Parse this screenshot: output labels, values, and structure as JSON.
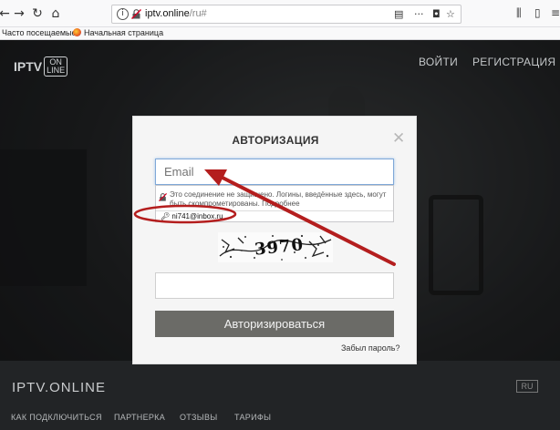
{
  "browser": {
    "url_host": "iptv.online",
    "url_path": "/ru#",
    "bookmarks": [
      "Часто посещаемые",
      "Начальная страница"
    ]
  },
  "site": {
    "logo_main": "IPTV",
    "logo_box_1": "ON",
    "logo_box_2": "LINE",
    "nav": [
      "ВОЙТИ",
      "РЕГИСТРАЦИЯ"
    ]
  },
  "modal": {
    "title": "АВТОРИЗАЦИЯ",
    "email_placeholder": "Email",
    "insecure_warning": "Это соединение не защищено. Логины, введённые здесь, могут быть скомпрометированы. Подробнее",
    "autofill_suggestion": "ni741@inbox.ru",
    "captcha_text": "3970",
    "submit_label": "Авторизироваться",
    "forgot_label": "Забыл пароль?"
  },
  "footer": {
    "brand": "IPTV.ONLINE",
    "lang": "RU",
    "nav": [
      "КАК ПОДКЛЮЧИТЬСЯ",
      "ПАРТНЕРКА",
      "ОТЗЫВЫ",
      "ТАРИФЫ"
    ]
  },
  "colors": {
    "annotation": "#b41e1e",
    "submit_bg": "#6b6b67"
  }
}
